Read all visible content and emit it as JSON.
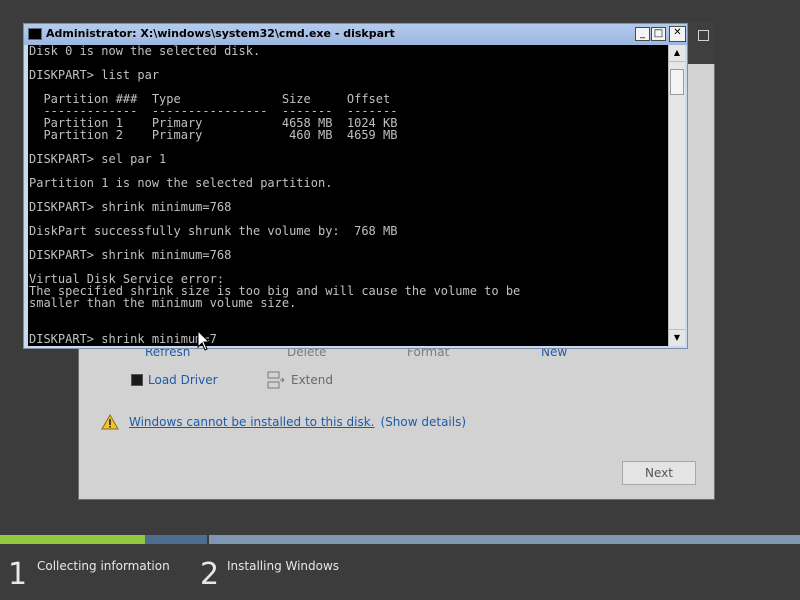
{
  "installer": {
    "tools": {
      "refresh_partial": "Refresh",
      "delete_partial": "Delete",
      "format_partial": "Format",
      "new_partial": "New",
      "load_driver": "Load Driver",
      "extend": "Extend"
    },
    "warning": {
      "message": "Windows cannot be installed to this disk.",
      "details_link": "(Show details)"
    },
    "next_label": "Next"
  },
  "cmd": {
    "title": "Administrator: X:\\windows\\system32\\cmd.exe - diskpart",
    "minimize_glyph": "_",
    "maximize_glyph": "□",
    "close_glyph": "✕",
    "scroll_up_glyph": "▲",
    "scroll_down_glyph": "▼",
    "console_text": "Disk 0 is now the selected disk.\n\nDISKPART> list par\n\n  Partition ###  Type              Size     Offset\n  -------------  ----------------  -------  -------\n  Partition 1    Primary           4658 MB  1024 KB\n  Partition 2    Primary            460 MB  4659 MB\n\nDISKPART> sel par 1\n\nPartition 1 is now the selected partition.\n\nDISKPART> shrink minimum=768\n\nDiskPart successfully shrunk the volume by:  768 MB\n\nDISKPART> shrink minimum=768\n\nVirtual Disk Service error:\nThe specified shrink size is too big and will cause the volume to be\nsmaller than the minimum volume size.\n\n\nDISKPART> shrink minimum=7"
  },
  "progress": {
    "step1_fraction": 0.7
  },
  "steps": [
    {
      "number": "1",
      "label": "Collecting information"
    },
    {
      "number": "2",
      "label": "Installing Windows"
    }
  ],
  "colors": {
    "progress_fill": "#92c83e",
    "link": "#1f5aa8"
  }
}
